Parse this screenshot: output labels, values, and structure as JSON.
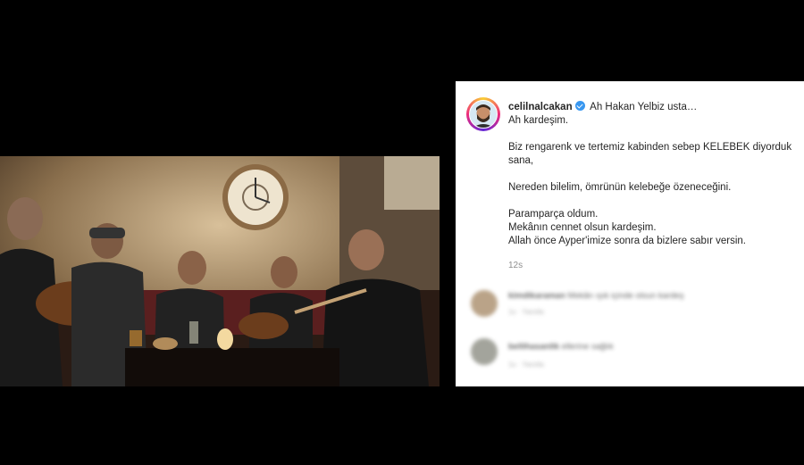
{
  "post": {
    "username": "celilnalcakan",
    "caption_lines": [
      "Ah Hakan Yelbiz usta…",
      "Ah kardeşim.",
      "",
      "Biz rengarenk ve tertemiz kabinden sebep KELEBEK diyorduk",
      "sana,",
      "",
      "Nereden bilelim, ömrünün kelebeğe özeneceğini.",
      "",
      "Paramparça oldum.",
      "Mekânın cennet olsun kardeşim.",
      "Allah önce Ayper'imize sonra da bizlere sabır versin."
    ],
    "time": "12s"
  },
  "comments": [
    {
      "username": "kimdikaraman",
      "text": "Mekân ışık içinde olsun kardeş",
      "meta": "1s · Yanıtla"
    },
    {
      "username": "bellihasanlik",
      "text": "ellerine sağlık",
      "meta": "1s · Yanıtla"
    }
  ],
  "icons": {
    "verified": "verified-badge-icon"
  },
  "colors": {
    "verified": "#3897f0",
    "username": "#262626",
    "timestamp": "#8e8e8e"
  }
}
